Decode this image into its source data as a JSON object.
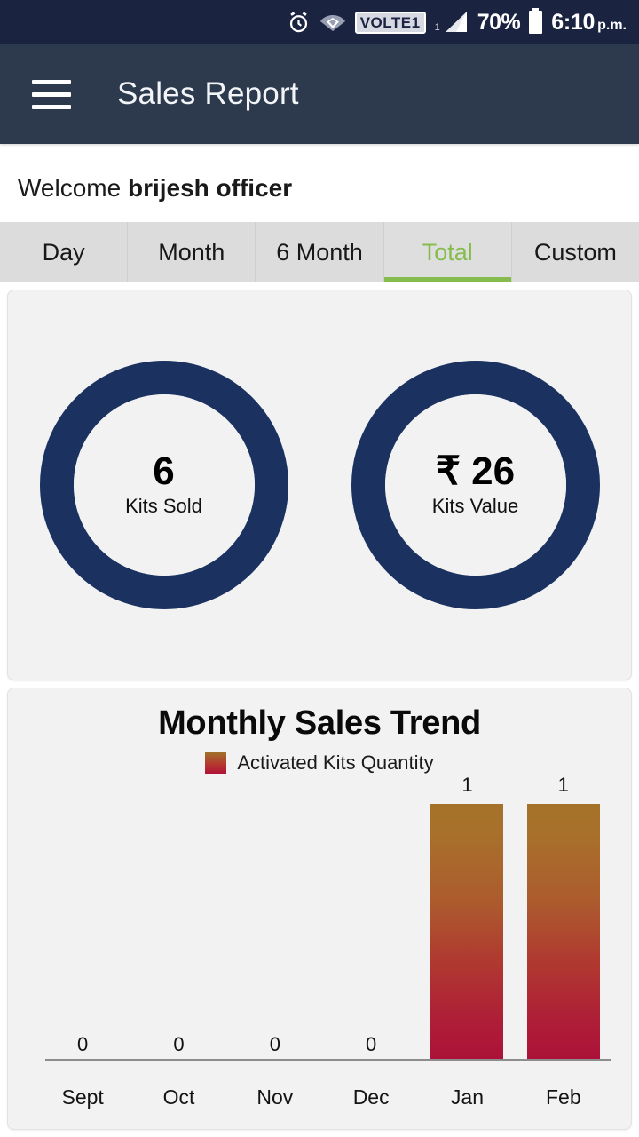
{
  "statusbar": {
    "alarm_icon": "alarm-clock-icon",
    "wifi_icon": "wifi-icon",
    "volte_badge": "VOLTE1",
    "signal_icon": "signal-bars-icon",
    "signal_sim": "1",
    "battery_percent": "70%",
    "battery_icon": "battery-icon",
    "time": "6:10",
    "ampm": "p.m."
  },
  "appbar": {
    "menu_icon": "hamburger-menu-icon",
    "title": "Sales Report"
  },
  "welcome": {
    "greeting": "Welcome",
    "user": "brijesh officer"
  },
  "tabs": {
    "items": [
      {
        "label": "Day",
        "active": false
      },
      {
        "label": "Month",
        "active": false
      },
      {
        "label": "6 Month",
        "active": false
      },
      {
        "label": "Total",
        "active": true
      },
      {
        "label": "Custom",
        "active": false
      }
    ],
    "active_color": "#86bc4d"
  },
  "summary": {
    "ring_color": "#1b3160",
    "donuts": [
      {
        "value": "6",
        "label": "Kits Sold"
      },
      {
        "value": "₹ 26",
        "label": "Kits Value"
      }
    ]
  },
  "chart_data": {
    "type": "bar",
    "title": "Monthly Sales Trend",
    "xlabel": "",
    "ylabel": "",
    "categories": [
      "Sept",
      "Oct",
      "Nov",
      "Dec",
      "Jan",
      "Feb"
    ],
    "values": [
      0,
      0,
      0,
      0,
      1,
      1
    ],
    "value_labels": [
      "0",
      "0",
      "0",
      "0",
      "1",
      "1"
    ],
    "series": [
      {
        "name": "Activated Kits Quantity",
        "values": [
          0,
          0,
          0,
          0,
          1,
          1
        ]
      }
    ],
    "legend": [
      {
        "label": "Activated Kits Quantity",
        "color_top": "#a5722a",
        "color_bottom": "#ac1139"
      }
    ],
    "legend_position": "top-center",
    "ylim": [
      0,
      1
    ],
    "grid": false,
    "bar_gradient_top": "#a5722a",
    "bar_gradient_bottom": "#ac1139",
    "axis_color": "#8d8d8d"
  }
}
